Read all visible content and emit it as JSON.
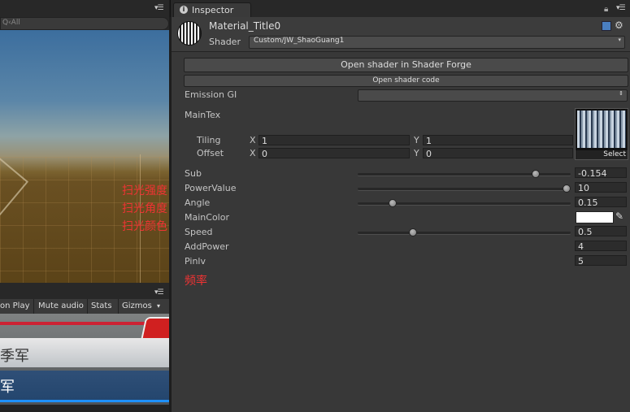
{
  "scene": {
    "search_placeholder": "Q‹All",
    "annotations": [
      "扫光强度",
      "扫光角度",
      "扫光颜色"
    ]
  },
  "game": {
    "toolbar": [
      "on Play",
      "Mute audio",
      "Stats",
      "Gizmos"
    ],
    "labels": [
      "季军",
      "军"
    ]
  },
  "inspector": {
    "tab_label": "Inspector",
    "material_title": "Material_Title0",
    "shader_label": "Shader",
    "shader_value": "Custom/JW_ShaoGuang1",
    "btn_open_forge": "Open shader in Shader Forge",
    "btn_open_code": "Open shader code",
    "emission_gi_label": "Emission GI",
    "maintex_label": "MainTex",
    "tiling_label": "Tiling",
    "offset_label": "Offset",
    "tiling_x": "1",
    "tiling_y": "1",
    "offset_x": "0",
    "offset_y": "0",
    "axis_x": "X",
    "axis_y": "Y",
    "tex_select": "Select",
    "props": [
      {
        "label": "Sub",
        "value": "-0.154",
        "slider": 0.85
      },
      {
        "label": "PowerValue",
        "value": "10",
        "slider": 1.0
      },
      {
        "label": "Angle",
        "value": "0.15",
        "slider": 0.15
      },
      {
        "label": "MainColor",
        "value": "",
        "color": "#ffffff"
      },
      {
        "label": "Speed",
        "value": "0.5",
        "slider": 0.25
      },
      {
        "label": "AddPower",
        "value": "4"
      },
      {
        "label": "Pinlv",
        "value": "5"
      }
    ],
    "annotation_freq": "频率"
  },
  "colors": {
    "annotation": "#e33333",
    "panel": "#383838"
  },
  "icons": [
    "search-icon",
    "info-icon",
    "lock-icon",
    "menu-icon",
    "book-icon",
    "gear-icon",
    "eyedropper-icon",
    "dropdown-arrow-icon"
  ]
}
